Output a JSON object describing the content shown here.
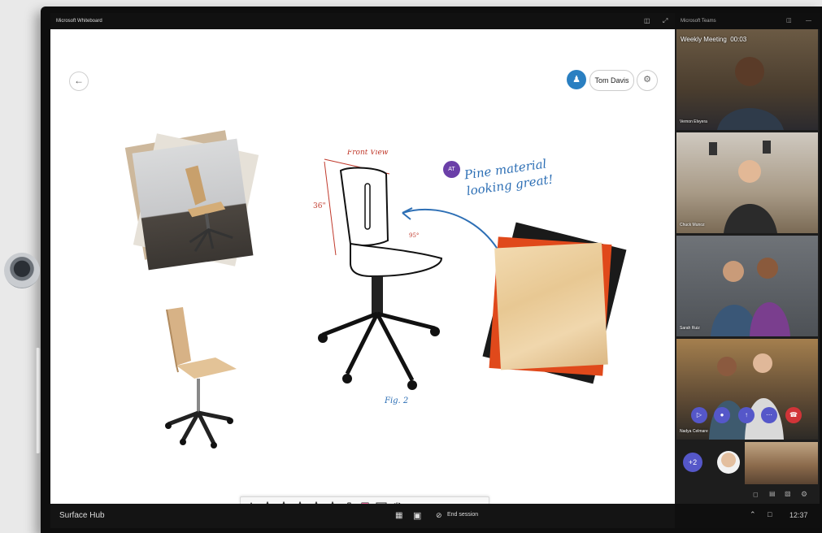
{
  "window_title": "Microsoft Whiteboard",
  "user": {
    "name": "Tom Davis"
  },
  "annotation": {
    "author_initials": "AT",
    "text_line1": "Pine material",
    "text_line2": "looking great!",
    "sketch_label": "Fig. 2",
    "sketch_title": "Front View",
    "dim_height": "36\"",
    "dim_angle": "95°"
  },
  "taskbar": {
    "device_name": "Surface Hub",
    "end_session": "End session"
  },
  "meeting": {
    "app_title": "Microsoft Teams",
    "title": "Weekly Meeting",
    "elapsed": "00:03",
    "participants": [
      "Vernon Elvyera",
      "Chuck Munoz",
      "Sarah Ruiz",
      "Nadya Celmare"
    ],
    "extra_count": "+2",
    "clock": "12:37"
  },
  "colors": {
    "accent": "#2a7fc1",
    "teams_purple": "#5557c9",
    "hangup_red": "#d13438"
  }
}
